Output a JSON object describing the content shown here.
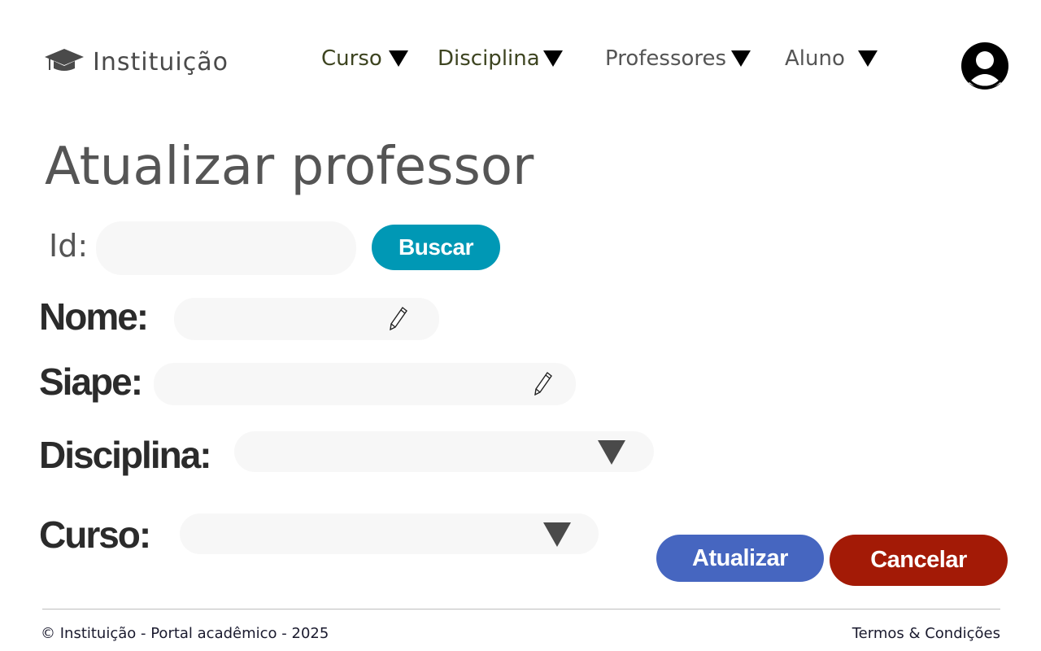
{
  "header": {
    "brand": "Instituição",
    "nav": [
      {
        "label": "Curso",
        "color": "#3d4420"
      },
      {
        "label": "Disciplina",
        "color": "#3d4420"
      },
      {
        "label": "Professores",
        "color": "#555555"
      },
      {
        "label": "Aluno",
        "color": "#555555"
      }
    ],
    "icons": {
      "brand": "graduation-cap-icon",
      "avatar": "user-avatar-icon",
      "caret": "caret-down-icon"
    }
  },
  "page": {
    "title": "Atualizar professor"
  },
  "search": {
    "label": "Id:",
    "value": "",
    "button": "Buscar",
    "button_color": "#0098b5"
  },
  "form": {
    "nome_label": "Nome:",
    "nome_value": "",
    "siape_label": "Siape:",
    "siape_value": "",
    "disciplina_label": "Disciplina:",
    "disciplina_value": "",
    "curso_label": "Curso:",
    "curso_value": ""
  },
  "actions": {
    "update": "Atualizar",
    "update_color": "#4666c0",
    "cancel": "Cancelar",
    "cancel_color": "#a31a06"
  },
  "footer": {
    "copyright": "© Instituição - Portal acadêmico - 2025",
    "terms": "Termos & Condições"
  }
}
